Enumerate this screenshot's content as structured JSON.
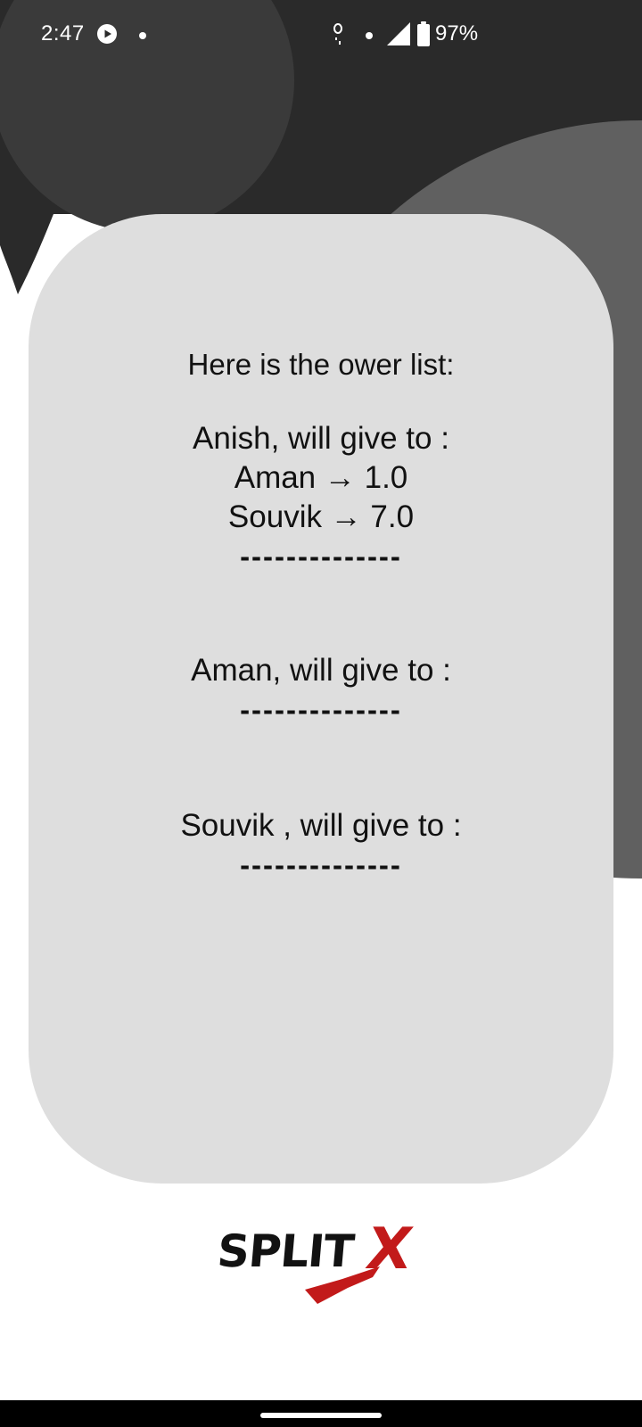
{
  "status_bar": {
    "time": "2:47",
    "battery_percent": "97%",
    "icons": [
      "play-icon",
      "notification-dot-icon",
      "misc-status-icon",
      "signal-icon",
      "battery-icon"
    ]
  },
  "card": {
    "heading": "Here is the ower list:",
    "entries": [
      {
        "title": "Anish, will give to :",
        "payments": [
          "Aman → 1.0",
          "Souvik  → 7.0"
        ],
        "divider": "--------------"
      },
      {
        "title": "Aman, will give to :",
        "payments": [],
        "divider": "--------------"
      },
      {
        "title": "Souvik , will give to :",
        "payments": [],
        "divider": "--------------"
      }
    ]
  },
  "logo": {
    "text": "SPLIT",
    "accent": "X"
  },
  "colors": {
    "background_dark": "#2a2a2a",
    "circle_mid": "#3a3a3a",
    "circle_gray": "#606060",
    "card_bg": "#dedede",
    "logo_red": "#c21a1a"
  }
}
